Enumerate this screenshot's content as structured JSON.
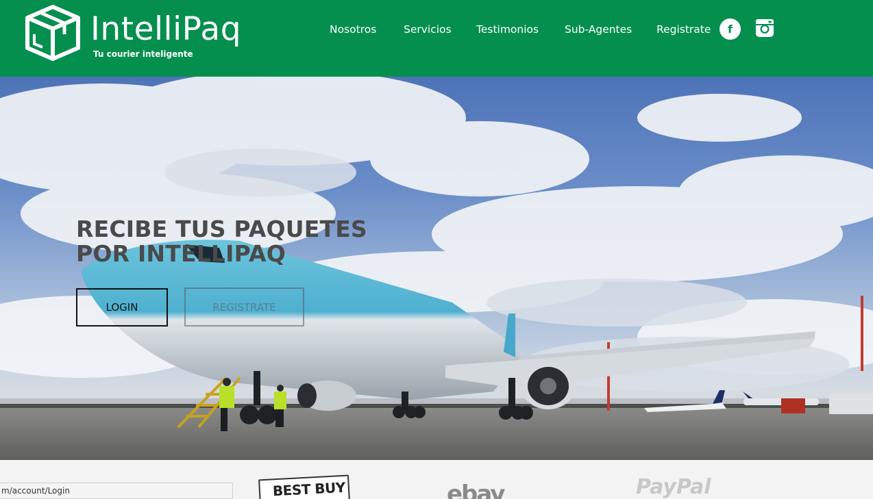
{
  "brand": {
    "name": "IntelliPaq",
    "tagline": "Tu courier inteligente"
  },
  "nav": {
    "items": [
      {
        "label": "Nosotros"
      },
      {
        "label": "Servicios"
      },
      {
        "label": "Testimonios"
      },
      {
        "label": "Sub-Agentes"
      },
      {
        "label": "Registrate"
      }
    ],
    "social": [
      {
        "icon": "facebook-icon",
        "glyph": "f"
      },
      {
        "icon": "instagram-icon"
      }
    ]
  },
  "hero": {
    "title": "RECIBE TUS PAQUETES POR INTELLIPAQ",
    "login_label": "LOGIN",
    "register_label": "REGISTRATE"
  },
  "partners": {
    "logos": [
      {
        "name": "BEST BUY"
      },
      {
        "name": "ebay"
      },
      {
        "name": "PayPal"
      }
    ]
  },
  "status_bar": {
    "url": "m/account/Login"
  },
  "colors": {
    "header_green": "#058f4f",
    "text_white": "#ffffff",
    "hero_title": "#4a4a4a"
  }
}
